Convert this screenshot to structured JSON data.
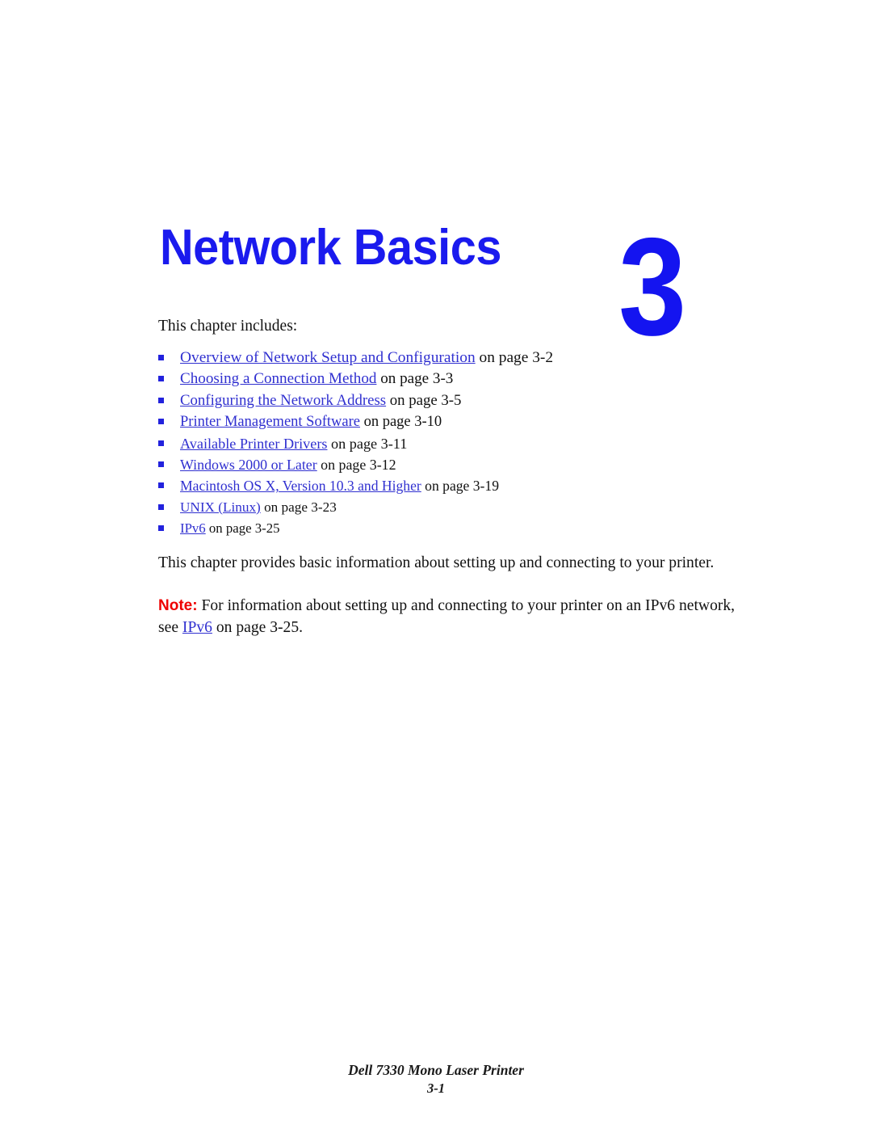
{
  "document": {
    "chapter_title": "Network Basics",
    "chapter_number": "3",
    "title_color": "#1a1aee",
    "number_color": "#1414f0",
    "link_color": "#3030d0",
    "note_color": "#ee0000"
  },
  "intro": {
    "line": "This chapter includes:"
  },
  "toc": {
    "items": [
      {
        "link": "Overview of Network Setup and Configuration",
        "page": " on page 3-2"
      },
      {
        "link": "Choosing a Connection Method",
        "page": " on page 3-3"
      },
      {
        "link": "Configuring the Network Address",
        "page": " on page 3-5"
      },
      {
        "link": "Printer Management Software",
        "page": " on page 3-10"
      },
      {
        "link": "Available Printer Drivers",
        "page": " on page 3-11"
      },
      {
        "link": "Windows 2000 or Later",
        "page": " on page 3-12"
      },
      {
        "link": "Macintosh OS X, Version 10.3 and Higher",
        "page": " on page 3-19"
      },
      {
        "link": "UNIX (Linux)",
        "page": " on page 3-23"
      },
      {
        "link": "IPv6",
        "page": " on page 3-25"
      }
    ]
  },
  "body": {
    "paragraph": "This chapter provides basic information about setting up and connecting to your printer."
  },
  "note": {
    "label": "Note:",
    "text_before_link": " For information about setting up and connecting to your printer on an IPv6 network, see ",
    "link": "IPv6",
    "text_after_link": " on page 3-25."
  },
  "footer": {
    "product": "Dell 7330 Mono Laser Printer",
    "page_number": "3-1"
  }
}
